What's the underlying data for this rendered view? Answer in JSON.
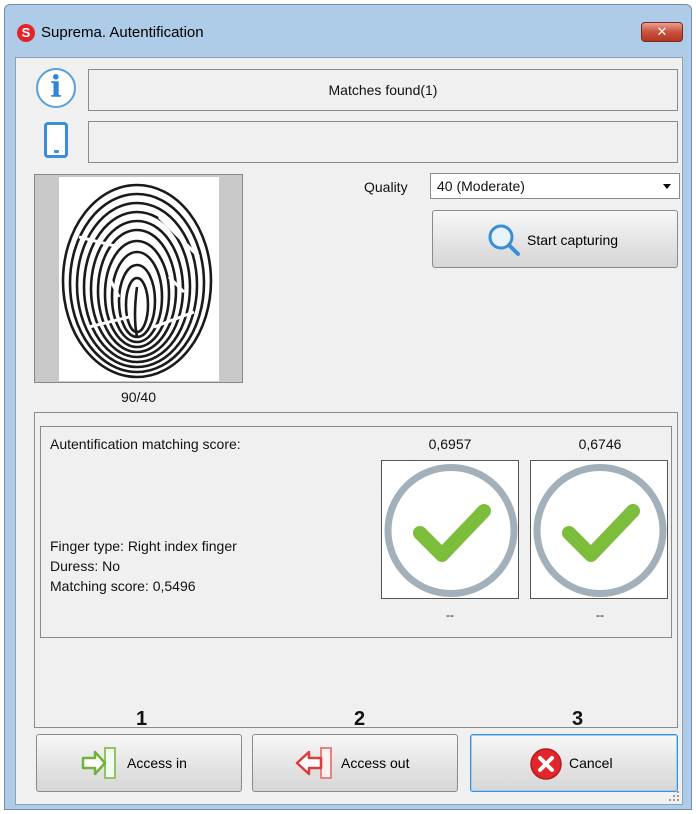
{
  "window": {
    "title": "Suprema. Autentification",
    "logo_letter": "S",
    "close_symbol": "✕"
  },
  "info_icon": {
    "glyph": "i",
    "icon": "info-icon"
  },
  "status": {
    "message": "Matches found(1)",
    "secondary": ""
  },
  "fingerprint": {
    "caption": "90/40"
  },
  "quality": {
    "label": "Quality",
    "selected": "40 (Moderate)"
  },
  "start_button": {
    "label": "Start capturing",
    "icon": "search-icon"
  },
  "results": {
    "title": "Autentification matching score:",
    "finger_type": "Finger type: Right index finger",
    "duress": "Duress: No",
    "matching_score": "Matching score: 0,5496",
    "scores": [
      {
        "value": "0,6957",
        "footer": "--"
      },
      {
        "value": "0,6746",
        "footer": "--"
      }
    ]
  },
  "steps": [
    "1",
    "2",
    "3"
  ],
  "buttons": {
    "access_in": "Access in",
    "access_out": "Access out",
    "cancel": "Cancel"
  },
  "colors": {
    "check_green": "#7cbd3c",
    "ring_grey": "#a3b0b9",
    "cancel_red": "#e0262a",
    "accent_blue": "#3c8ed6"
  }
}
